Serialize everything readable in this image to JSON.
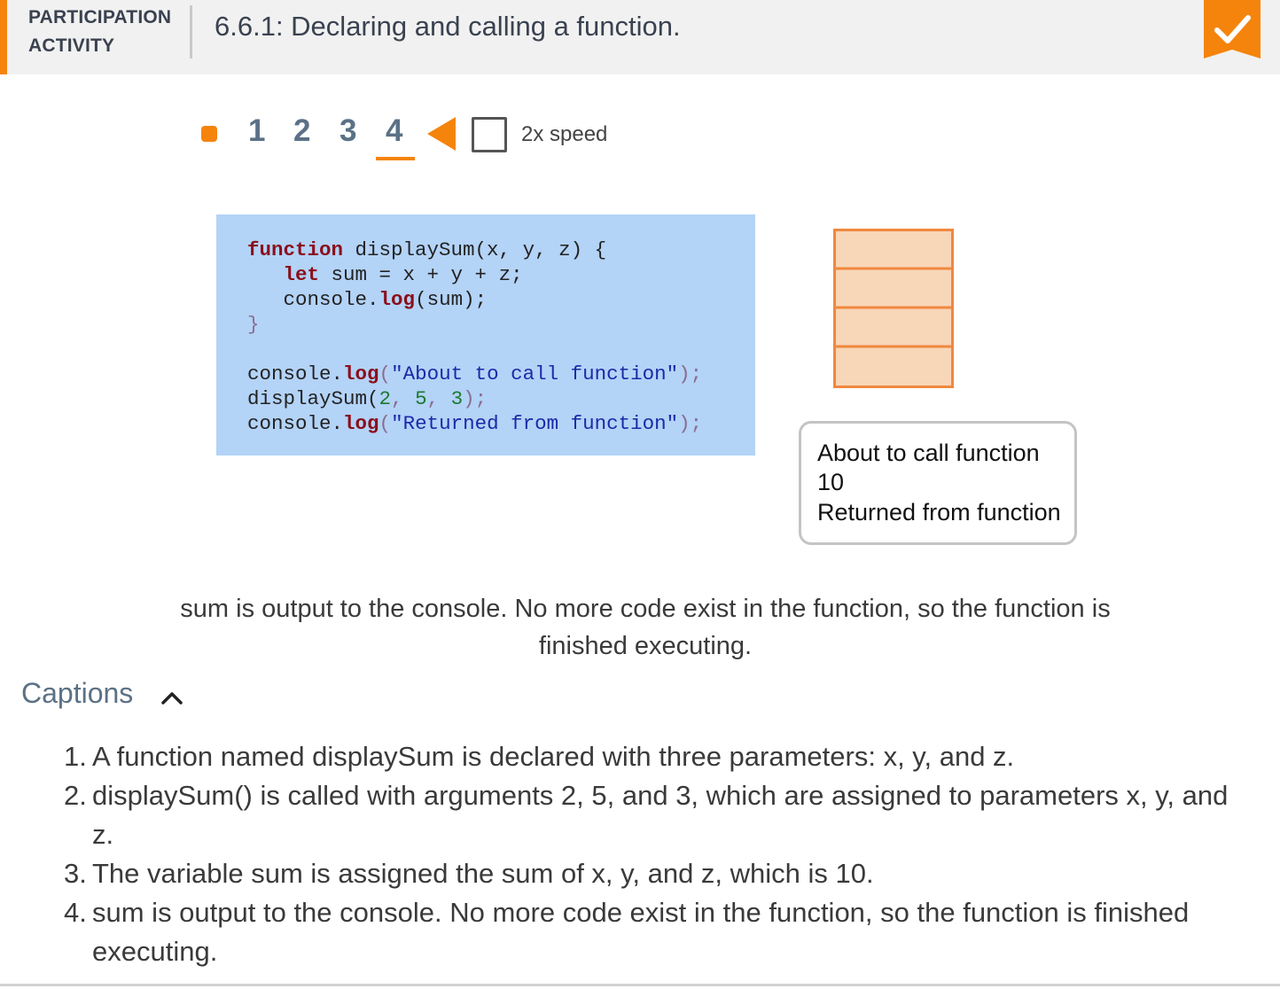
{
  "header": {
    "label_line1": "PARTICIPATION",
    "label_line2": "ACTIVITY",
    "title": "6.6.1: Declaring and calling a function."
  },
  "steps": {
    "items": [
      "1",
      "2",
      "3",
      "4"
    ],
    "current": 4,
    "speed_label": "2x speed",
    "speed_checked": false
  },
  "code": {
    "line1": {
      "kw": "function",
      "rest": " displaySum(x, y, z) {"
    },
    "line2": {
      "kw": "let",
      "rest": " sum = x + y + z;"
    },
    "line3": {
      "obj": "console.",
      "fn": "log",
      "rest": "(sum);"
    },
    "line4": "}",
    "line5": {
      "obj": "console.",
      "fn": "log",
      "str": "\"About to call function\""
    },
    "line6": {
      "name": "displaySum(",
      "a": "2",
      "b": "5",
      "c": "3"
    },
    "line7": {
      "obj": "console.",
      "fn": "log",
      "str": "\"Returned from function\""
    }
  },
  "console": {
    "lines": [
      "About to call function",
      "10",
      "Returned from function"
    ]
  },
  "current_caption": "sum is output to the console. No more code exist in the function, so the function is finished executing.",
  "captions": {
    "label": "Captions",
    "expanded": true,
    "items": [
      "A function named displaySum is declared with three parameters: x, y, and z.",
      "displaySum() is called with arguments 2, 5, and 3, which are assigned to parameters x, y, and z.",
      "The variable sum is assigned the sum of x, y, and z, which is 10.",
      "sum is output to the console. No more code exist in the function, so the function is finished executing."
    ]
  },
  "colors": {
    "accent": "#f5840c",
    "code_bg": "#b3d3f7",
    "step_number": "#5b7186",
    "stack_fill": "#f8d6b8",
    "stack_border": "#f0883e"
  }
}
